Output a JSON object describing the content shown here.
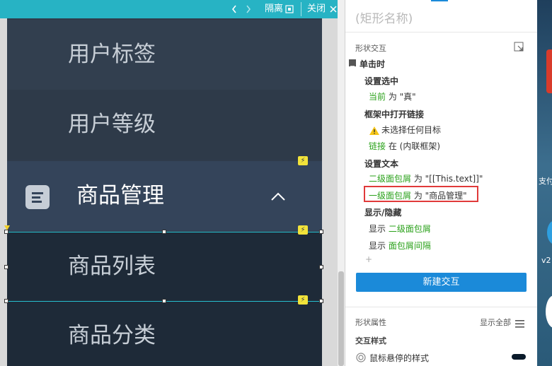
{
  "toolbar": {
    "prev_icon": "chevron-left-icon",
    "next_icon": "chevron-right-icon",
    "isolate_label": "隔离",
    "close_label": "关闭",
    "close_icon": "close-icon"
  },
  "menu": {
    "items": [
      {
        "label": "用户标签"
      },
      {
        "label": "用户等级"
      },
      {
        "label": "商品管理",
        "icon": "document-icon",
        "expand_icon": "chevron-up-icon"
      },
      {
        "label": "商品列表"
      },
      {
        "label": "商品分类"
      }
    ]
  },
  "panel": {
    "shape_name_placeholder": "(矩形名称)",
    "section_interaction": "形状交互",
    "event_label": "单击时",
    "actions": [
      {
        "title": "设置选中",
        "lines": [
          {
            "target": "当前",
            "rest": " 为 \"真\""
          }
        ]
      },
      {
        "title": "框架中打开链接",
        "lines": [
          {
            "warning": "未选择任何目标"
          },
          {
            "target": "链接",
            "rest": " 在 (内联框架)"
          }
        ]
      },
      {
        "title": "设置文本",
        "lines": [
          {
            "target": "二级面包屑",
            "rest": " 为 \"[[This.text]]\""
          },
          {
            "target": "一级面包屑",
            "rest": " 为 \"商品管理\""
          }
        ]
      },
      {
        "title": "显示/隐藏",
        "lines": [
          {
            "prefix": "显示 ",
            "target": "二级面包屑"
          },
          {
            "prefix": "显示 ",
            "target": "面包屑间隔"
          }
        ]
      }
    ],
    "add_symbol": "+",
    "new_interaction_label": "新建交互",
    "shape_props_label": "形状属性",
    "show_all_label": "显示全部",
    "interaction_style_label": "交互样式",
    "hover_style_label": "鼠标悬停的样式",
    "accent_color": "#1b8ad9",
    "highlight_border_color": "#e03a3a"
  },
  "desktop": {
    "text_1": "支付",
    "text_2": "v2"
  }
}
